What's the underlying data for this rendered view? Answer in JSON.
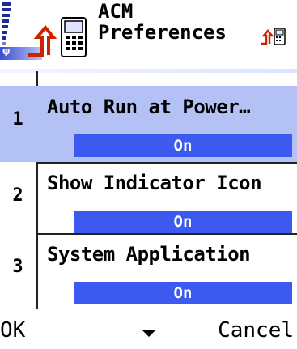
{
  "header": {
    "title_line1": "ACM",
    "title_line2": "Preferences",
    "app_icon": "phone-settings-icon",
    "indicator_icon": "small-phone-indicator-icon",
    "signal_icon": "signal-strength-icon",
    "antenna_icon": "antenna-icon",
    "antenna_glyph": "Ψ"
  },
  "settings": {
    "items": [
      {
        "number": "1",
        "label": "Auto Run at Power…",
        "value": "On",
        "selected": true
      },
      {
        "number": "2",
        "label": "Show Indicator Icon",
        "value": "On",
        "selected": false
      },
      {
        "number": "3",
        "label": "System Application",
        "value": "On",
        "selected": false
      }
    ]
  },
  "softkeys": {
    "left": "OK",
    "right": "Cancel",
    "middle_icon": "scroll-down-arrow-icon"
  },
  "colors": {
    "selection": "#b3c1f5",
    "value_bar": "#3c5aef",
    "signal": "#1b2d9a"
  }
}
